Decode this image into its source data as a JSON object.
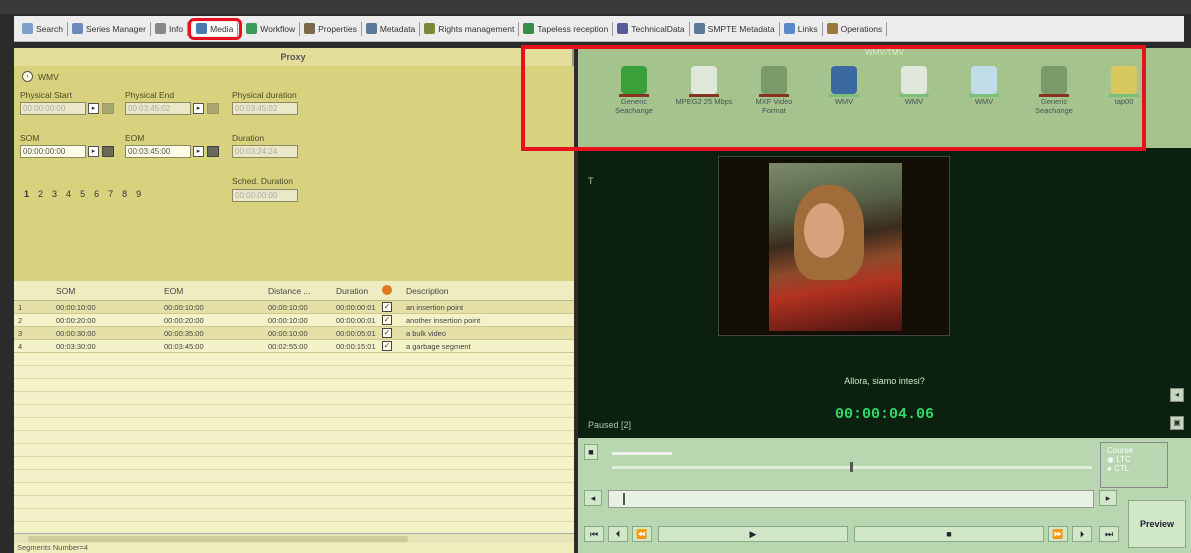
{
  "tabs": [
    {
      "label": "Search",
      "icon": "search-icon",
      "active": false
    },
    {
      "label": "Series Manager",
      "icon": "series-manager-icon",
      "active": false
    },
    {
      "label": "Info",
      "icon": "info-icon",
      "active": false
    },
    {
      "label": "Media",
      "icon": "media-icon",
      "active": true
    },
    {
      "label": "Workflow",
      "icon": "workflow-icon",
      "active": false
    },
    {
      "label": "Properties",
      "icon": "properties-icon",
      "active": false
    },
    {
      "label": "Metadata",
      "icon": "metadata-icon",
      "active": false
    },
    {
      "label": "Rights management",
      "icon": "rights-icon",
      "active": false
    },
    {
      "label": "Tapeless reception",
      "icon": "tapeless-icon",
      "active": false
    },
    {
      "label": "TechnicalData",
      "icon": "technical-icon",
      "active": false
    },
    {
      "label": "SMPTE Metadata",
      "icon": "smpte-icon",
      "active": false
    },
    {
      "label": "Links",
      "icon": "links-icon",
      "active": false
    },
    {
      "label": "Operations",
      "icon": "operations-icon",
      "active": false
    }
  ],
  "proxy": {
    "title": "Proxy",
    "format": "WMV",
    "physical_start_label": "Physical Start",
    "physical_start": "00:00:00:00",
    "physical_end_label": "Physical End",
    "physical_end": "00:03:45:02",
    "physical_duration_label": "Physical duration",
    "physical_duration": "00:03:45:02",
    "som_label": "SOM",
    "som": "00:00:00:00",
    "eom_label": "EOM",
    "eom": "00:03:45:00",
    "duration_label": "Duration",
    "duration": "00:03:24:24",
    "sched_duration_label": "Sched. Duration",
    "sched_duration": "00:00:00:00",
    "pages": [
      "1",
      "2",
      "3",
      "4",
      "5",
      "6",
      "7",
      "8",
      "9"
    ]
  },
  "grid": {
    "headers": [
      "SOM",
      "EOM",
      "Distance ...",
      "Duration",
      "Description"
    ],
    "rows": [
      {
        "num": "1",
        "som": "00:00:10:00",
        "eom": "00:00:10:00",
        "distance": "00:00:10:00",
        "duration": "00:00:00:01",
        "checked": true,
        "description": "an insertion point"
      },
      {
        "num": "2",
        "som": "00:00:20:00",
        "eom": "00:00:20:00",
        "distance": "00:00:10:00",
        "duration": "00:00:00:01",
        "checked": true,
        "description": "another insertion point"
      },
      {
        "num": "3",
        "som": "00:00:30:00",
        "eom": "00:00:35:00",
        "distance": "00:00:10:00",
        "duration": "00:00:05:01",
        "checked": true,
        "description": "a bulk video"
      },
      {
        "num": "4",
        "som": "00:03:30:00",
        "eom": "00:03:45:00",
        "distance": "00:02:55:00",
        "duration": "00:00:15:01",
        "checked": true,
        "description": "a garbage segment"
      }
    ]
  },
  "status": "Segments Number=4",
  "media_strip": {
    "title": "WMV/TMV",
    "items": [
      {
        "label": "Generic Seachange",
        "icon": "bea-icon",
        "color": "#3aa03a",
        "bar": "#883322"
      },
      {
        "label": "MPEG2 25 Mbps",
        "icon": "mpeg-icon",
        "color": "#dfe8da",
        "bar": "#883322"
      },
      {
        "label": "MXF Video Format",
        "icon": "mxf-icon",
        "color": "#7a9a6a",
        "bar": "#883322"
      },
      {
        "label": "WMV",
        "icon": "wmv-icon",
        "color": "#3a6aa0",
        "bar": "#7ac07a"
      },
      {
        "label": "WMV",
        "icon": "info-circle-icon",
        "color": "#dfe8da",
        "bar": "#7ac07a"
      },
      {
        "label": "WMV",
        "icon": "disc-icon",
        "color": "#c0dce8",
        "bar": "#7ac07a"
      },
      {
        "label": "Generic Seachange",
        "icon": "seachange-icon",
        "color": "#7a9a6a",
        "bar": "#883322"
      },
      {
        "label": "tap00",
        "icon": "tape-icon",
        "color": "#d8c860",
        "bar": "#7ac07a"
      }
    ]
  },
  "player": {
    "subtitle": "Allora, siamo intesi?",
    "timecode": "00:00:04.06",
    "state": "Paused [2]",
    "t_marker": "T",
    "course_label": "Course",
    "course_options": [
      "LTC",
      "CTL"
    ],
    "preview_label": "Preview"
  }
}
